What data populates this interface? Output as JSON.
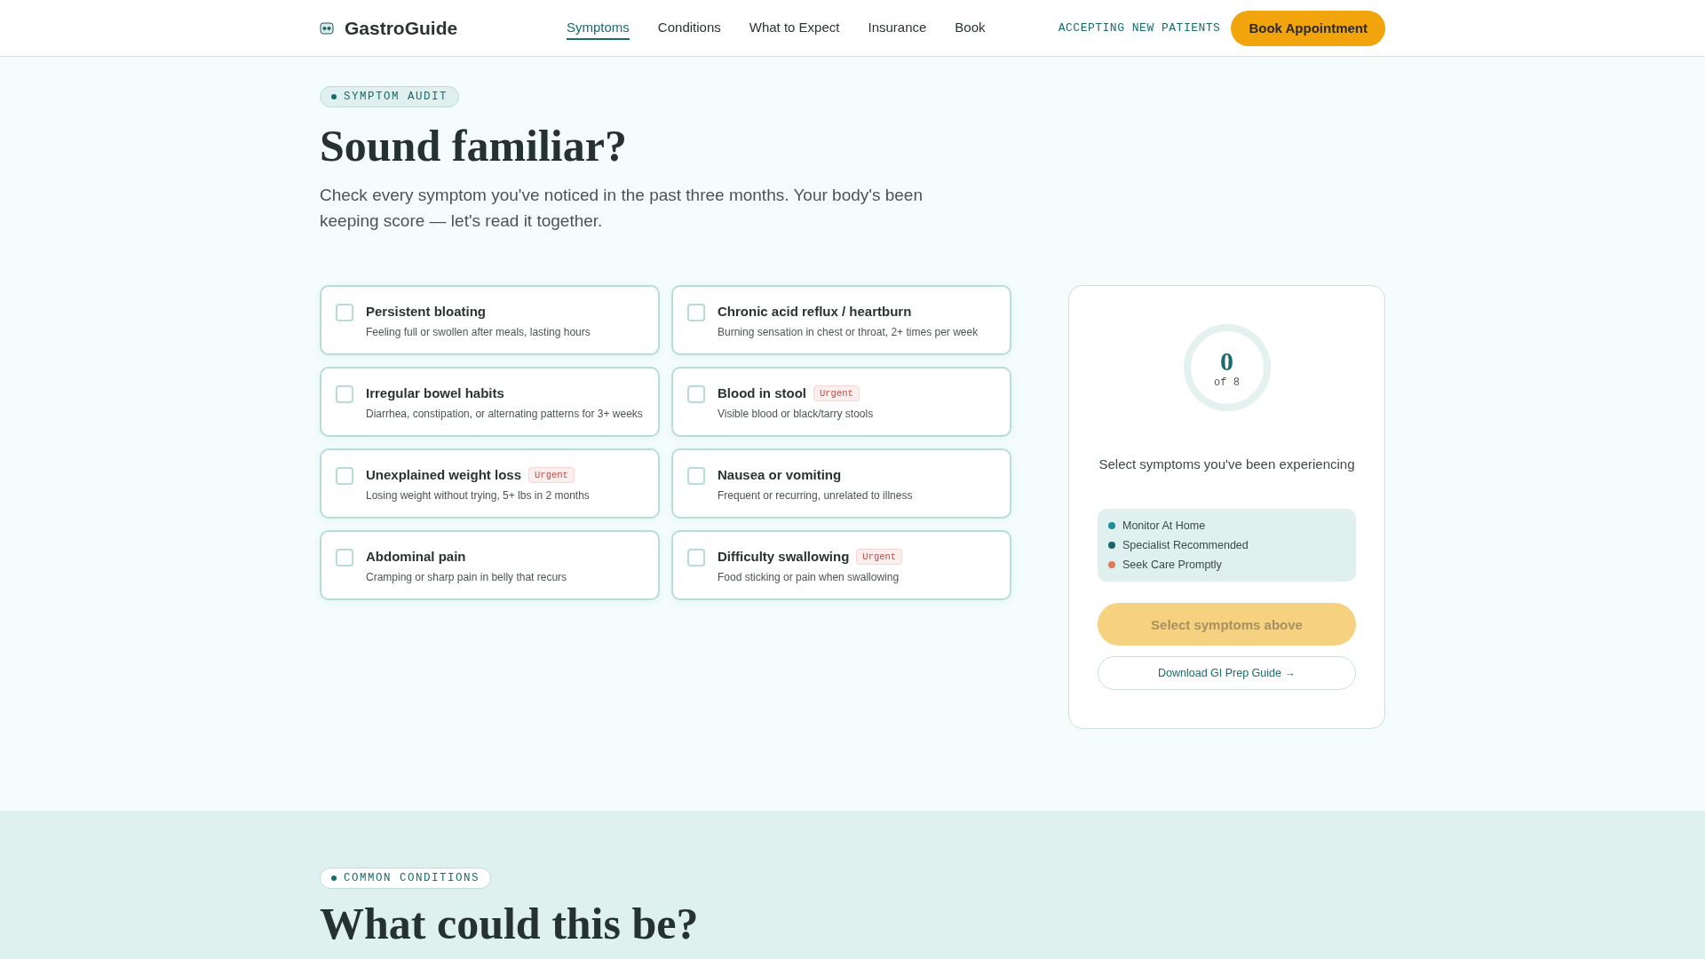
{
  "header": {
    "brand": "GastroGuide",
    "nav": [
      {
        "label": "Symptoms",
        "selected": true
      },
      {
        "label": "Conditions",
        "selected": false
      },
      {
        "label": "What to Expect",
        "selected": false
      },
      {
        "label": "Insurance",
        "selected": false
      },
      {
        "label": "Book",
        "selected": false
      }
    ],
    "status": "ACCEPTING NEW PATIENTS",
    "cta": "Book Appointment"
  },
  "hero": {
    "eyebrow": "SYMPTOM AUDIT",
    "title": "Sound familiar?",
    "intro": "Check every symptom you've noticed in the past three months. Your body's been keeping score — let's read it together."
  },
  "symptoms": [
    {
      "title": "Persistent bloating",
      "detail": "Feeling full or swollen after meals, lasting hours",
      "checked": false
    },
    {
      "title": "Chronic acid reflux / heartburn",
      "detail": "Burning sensation in chest or throat, 2+ times per week",
      "checked": false
    },
    {
      "title": "Irregular bowel habits",
      "detail": "Diarrhea, constipation, or alternating patterns for 3+ weeks",
      "checked": false
    },
    {
      "title": "Blood in stool",
      "badge": "Urgent",
      "detail": "Visible blood or black/tarry stools",
      "checked": false
    },
    {
      "title": "Unexplained weight loss",
      "badge": "Urgent",
      "detail": "Losing weight without trying, 5+ lbs in 2 months",
      "checked": false
    },
    {
      "title": "Nausea or vomiting",
      "detail": "Frequent or recurring, unrelated to illness",
      "checked": false
    },
    {
      "title": "Abdominal pain",
      "detail": "Cramping or sharp pain in belly that recurs",
      "checked": false
    },
    {
      "title": "Difficulty swallowing",
      "badge": "Urgent",
      "detail": "Food sticking or pain when swallowing",
      "checked": false
    }
  ],
  "summary": {
    "count": "0",
    "total": "of 8",
    "prompt": "Select symptoms you've been experiencing",
    "legend": [
      {
        "label": "Monitor At Home",
        "color": "#1e8f98"
      },
      {
        "label": "Specialist Recommended",
        "color": "#16666a"
      },
      {
        "label": "Seek Care Promptly",
        "color": "#e07a5f"
      }
    ],
    "action": {
      "label": "Select symptoms above",
      "disabled": true
    },
    "download": "Download GI Prep Guide →"
  },
  "conditions": {
    "eyebrow": "COMMON CONDITIONS",
    "title": "What could this be?"
  }
}
